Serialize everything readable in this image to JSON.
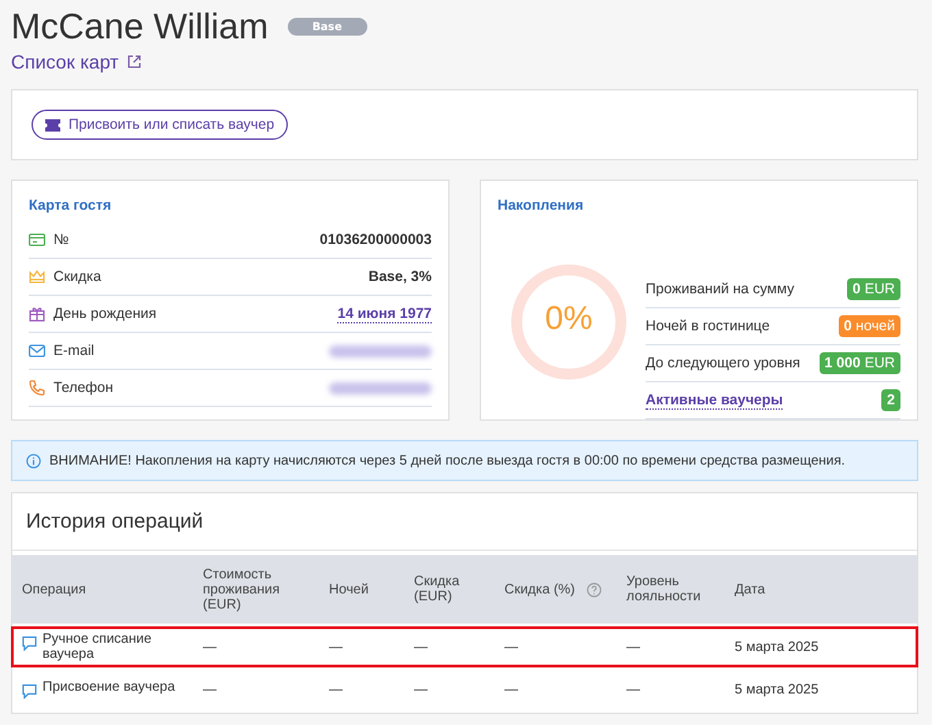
{
  "header": {
    "name": "McCane William",
    "tier_badge": "Base",
    "cards_link": "Список карт"
  },
  "voucher_button": "Присвоить или списать ваучер",
  "guest_card": {
    "title": "Карта гостя",
    "rows": [
      {
        "kind": "card",
        "label": "№",
        "value": "01036200000003",
        "link": false,
        "blurred": false
      },
      {
        "kind": "crown",
        "label": "Скидка",
        "value": "Base, 3%",
        "link": false,
        "blurred": false
      },
      {
        "kind": "gift",
        "label": "День рождения",
        "value": "14 июня 1977",
        "link": true,
        "blurred": false
      },
      {
        "kind": "mail",
        "label": "E-mail",
        "link": false,
        "blurred": true
      },
      {
        "kind": "phone",
        "label": "Телефон",
        "link": false,
        "blurred": true
      }
    ]
  },
  "savings": {
    "title": "Накопления",
    "ring": {
      "reading": "0%",
      "level": 0
    },
    "rows": [
      {
        "label": "Проживаний на сумму",
        "badge_parts": [
          "0",
          "EUR"
        ],
        "color": "#4caf50",
        "link": false
      },
      {
        "label": "Ночей в гостинице",
        "badge_parts": [
          "0",
          "ночей"
        ],
        "color": "#fb8c2c",
        "link": false
      },
      {
        "label": "До следующего уровня",
        "badge_parts": [
          "1 000",
          "EUR"
        ],
        "color": "#4caf50",
        "link": false
      },
      {
        "label": "Активные ваучеры",
        "badge_parts": [
          "2"
        ],
        "color": "#4caf50",
        "link": true
      }
    ]
  },
  "notice": "ВНИМАНИЕ! Накопления на карту начисляются через 5 дней после выезда гостя в 00:00 по времени средства размещения.",
  "history": {
    "title": "История операций",
    "columns": [
      {
        "label": "Операция",
        "help": false
      },
      {
        "label": "Стоимость проживания (EUR)",
        "help": false
      },
      {
        "label": "Ночей",
        "help": false
      },
      {
        "label": "Скидка (EUR)",
        "help": false
      },
      {
        "label": "Скидка (%)",
        "help": true
      },
      {
        "label": "Уровень лояльности",
        "help": false
      },
      {
        "label": "Дата",
        "help": false
      }
    ],
    "rows": [
      {
        "highlighted": true,
        "cells": [
          "Ручное списание ваучера",
          "—",
          "—",
          "—",
          "—",
          "—",
          "5 марта 2025"
        ]
      },
      {
        "highlighted": false,
        "cells": [
          "Присвоение ваучера",
          "—",
          "—",
          "—",
          "—",
          "—",
          "5 марта 2025"
        ]
      }
    ]
  }
}
